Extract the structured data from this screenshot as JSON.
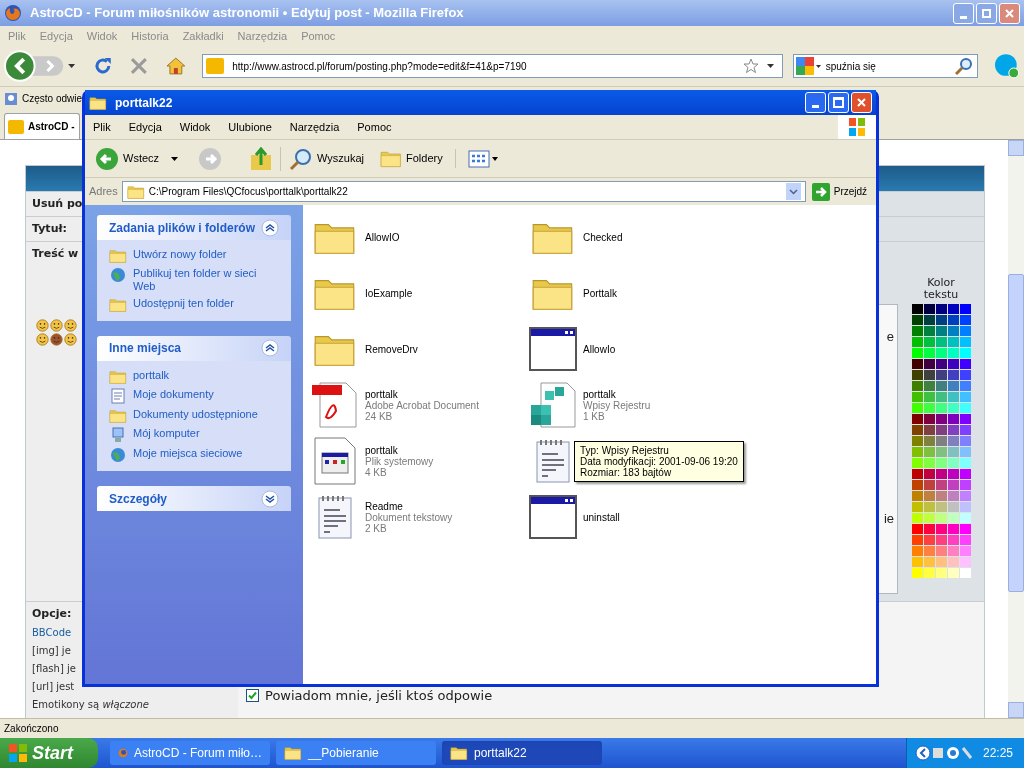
{
  "browser": {
    "title": "AstroCD - Forum miłośników astronomii • Edytuj post - Mozilla Firefox",
    "menu": [
      "Plik",
      "Edycja",
      "Widok",
      "Historia",
      "Zakładki",
      "Narzędzia",
      "Pomoc"
    ],
    "url": "http://www.astrocd.pl/forum/posting.php?mode=edit&f=41&p=7190",
    "search": "spuźnia się",
    "bookmarks": [
      "Często odwie"
    ],
    "tabs": [
      {
        "label": "AstroCD -",
        "selected": true
      }
    ],
    "status": "Zakończono"
  },
  "forum": {
    "rows": [
      "Usuń po",
      "Tytuł:",
      "Treść w"
    ],
    "options_title": "Opcje:",
    "options": [
      {
        "text": "BBCode",
        "kind": "link"
      },
      {
        "text": "[img] je",
        "kind": "plain"
      },
      {
        "text": "[flash] je",
        "kind": "plain"
      },
      {
        "text": "[url] jest",
        "kind": "plain"
      },
      {
        "text": "Emotikony są *włączone*",
        "kind": "plain"
      }
    ],
    "color_label": "Kolor tekstu",
    "fragments": [
      "e",
      "ie"
    ],
    "checkboxes": [
      {
        "label": "Powiadom mnie, jeśli ktoś odpowie",
        "checked": true
      }
    ]
  },
  "explorer": {
    "title": "porttalk22",
    "menu": [
      "Plik",
      "Edycja",
      "Widok",
      "Ulubione",
      "Narzędzia",
      "Pomoc"
    ],
    "toolbar": [
      {
        "kind": "back",
        "label": "Wstecz"
      },
      {
        "kind": "forward"
      },
      {
        "kind": "up"
      },
      {
        "kind": "search",
        "label": "Wyszukaj"
      },
      {
        "kind": "folders",
        "label": "Foldery"
      },
      {
        "kind": "views"
      }
    ],
    "address_label": "Adres",
    "address": "C:\\Program Files\\QCfocus\\porttalk\\porttalk22",
    "go": "Przejdź",
    "panels": [
      {
        "title": "Zadania plików i folderów",
        "expanded": true,
        "links": [
          {
            "text": "Utwórz nowy folder",
            "kind": "folder"
          },
          {
            "text": "Publikuj ten folder w sieci Web",
            "kind": "globe"
          },
          {
            "text": "Udostępnij ten folder",
            "kind": "folder"
          }
        ]
      },
      {
        "title": "Inne miejsca",
        "expanded": true,
        "links": [
          {
            "text": "porttalk",
            "kind": "folder"
          },
          {
            "text": "Moje dokumenty",
            "kind": "document"
          },
          {
            "text": "Dokumenty udostępnione",
            "kind": "folder"
          },
          {
            "text": "Mój komputer",
            "kind": "computer"
          },
          {
            "text": "Moje miejsca sieciowe",
            "kind": "globe"
          }
        ]
      },
      {
        "title": "Szczegóły",
        "expanded": false
      }
    ],
    "files": [
      {
        "name": "AllowIO",
        "kind": "folder"
      },
      {
        "name": "Checked",
        "kind": "folder"
      },
      {
        "name": "IoExample",
        "kind": "folder"
      },
      {
        "name": "Porttalk",
        "kind": "folder"
      },
      {
        "name": "RemoveDrv",
        "kind": "folder"
      },
      {
        "name": "AllowIo",
        "kind": "app"
      },
      {
        "name": "porttalk",
        "type": "Adobe Acrobat Document",
        "size": "24 KB",
        "kind": "pdf"
      },
      {
        "name": "porttalk",
        "type": "Wpisy Rejestru",
        "size": "1 KB",
        "kind": "registry"
      },
      {
        "name": "porttalk",
        "type": "Plik systemowy",
        "size": "4 KB",
        "kind": "system"
      },
      {
        "kind": "text"
      },
      {
        "name": "Readme",
        "type": "Dokument tekstowy",
        "size": "2 KB",
        "kind": "text"
      },
      {
        "name": "uninstall",
        "kind": "app"
      }
    ],
    "tooltip": [
      "Typ: Wpisy Rejestru",
      "Data modyfikacji: 2001-09-06 19:20",
      "Rozmiar: 183 bajtów"
    ]
  },
  "taskbar": {
    "start": "Start",
    "tasks": [
      {
        "label": "AstroCD - Forum miło…",
        "kind": "browser",
        "selected": false
      },
      {
        "label": "__Pobieranie",
        "kind": "folder",
        "selected": false
      },
      {
        "label": "porttalk22",
        "kind": "folder",
        "selected": true
      }
    ],
    "clock": "22:25"
  }
}
